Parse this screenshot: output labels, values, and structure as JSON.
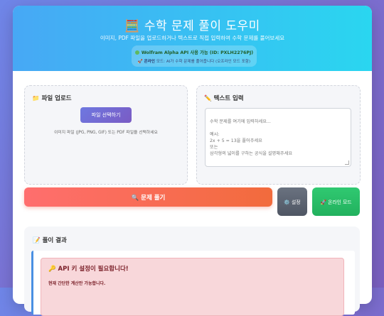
{
  "header": {
    "title_icon": "🧮",
    "title": "수학 문제 풀이 도우미",
    "subtitle": "이미지, PDF 파일을 업로드하거나 텍스트로 직접 입력하여 수학 문제를 풀어보세요",
    "api_status": "Wolfram Alpha API 사용 가능 (ID: PXLH2276PJ)",
    "online_label": "온라인",
    "online_desc": "모드: AI가 수학 문제를 풀어줍니다 (오프라인 모드 포함)"
  },
  "upload": {
    "icon": "📁",
    "title": "파일 업로드",
    "button_label": "파일 선택하기",
    "hint": "이미지 파일 (JPG, PNG, GIF) 또는 PDF 파일을 선택하세요"
  },
  "text_input": {
    "icon": "✏️",
    "title": "텍스트 입력",
    "placeholder": "수학 문제를 여기에 입력하세요...\n\n예시:\n2x + 5 = 13을 풀어주세요\n또는\n삼각형의 넓이를 구하는 공식을 설명해주세요"
  },
  "actions": {
    "solve_label": "🔍 문제 풀기",
    "settings_label": "⚙️ 설정",
    "online_label": "🚀 온라인 모드"
  },
  "result": {
    "icon": "📝",
    "title": "풀이 결과",
    "alert_title": "🔑 API 키 설정이 필요합니다!",
    "alert_text": "현재 간단한 계산만 가능합니다."
  },
  "colors": {
    "header_gradient_start": "#47a8f5",
    "header_gradient_end": "#2ad6f0",
    "solve_button": "#ff6e6e",
    "online_button": "#30c971",
    "settings_button": "#5f6672",
    "alert_bg": "#f8d7da"
  }
}
